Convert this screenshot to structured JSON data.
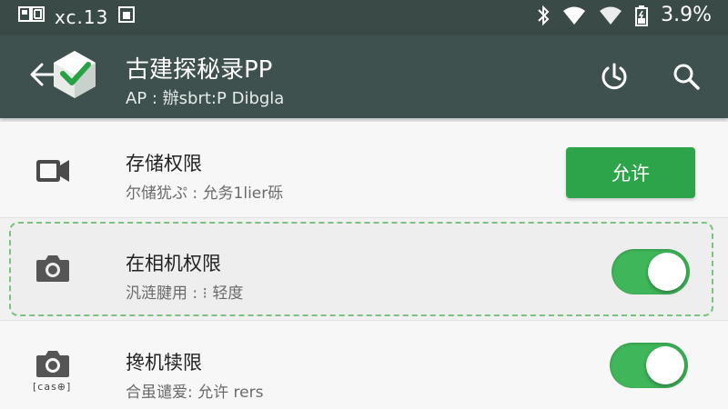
{
  "status_bar": {
    "left_text": "xc​.13",
    "battery_percent": "3.9%"
  },
  "app_bar": {
    "title": "古建探秘录PP",
    "subtitle": "AP : 辦sbrt:P Dibgla"
  },
  "permissions": [
    {
      "title": "存储权限",
      "subtitle": "尔储犹ぷ : 允务1lier砾",
      "icon": "video-camera-icon",
      "control": "button",
      "button_label": "允许"
    },
    {
      "title": "在相机权限",
      "subtitle": "汎涟腱用 : ⁝ 轻度",
      "icon": "camera-icon",
      "control": "toggle",
      "enabled": true,
      "highlighted": true
    },
    {
      "title": "搀机犊限",
      "subtitle": "合虽谴爱: 允许 rers",
      "icon": "camera-icon",
      "control": "toggle",
      "enabled": true,
      "icon_caption": "[cas⊕]"
    }
  ],
  "colors": {
    "status_bar_bg": "#3a4a47",
    "app_bar_bg": "#3f514e",
    "accent_green": "#2ea44a",
    "toggle_green": "#3fb65a"
  }
}
